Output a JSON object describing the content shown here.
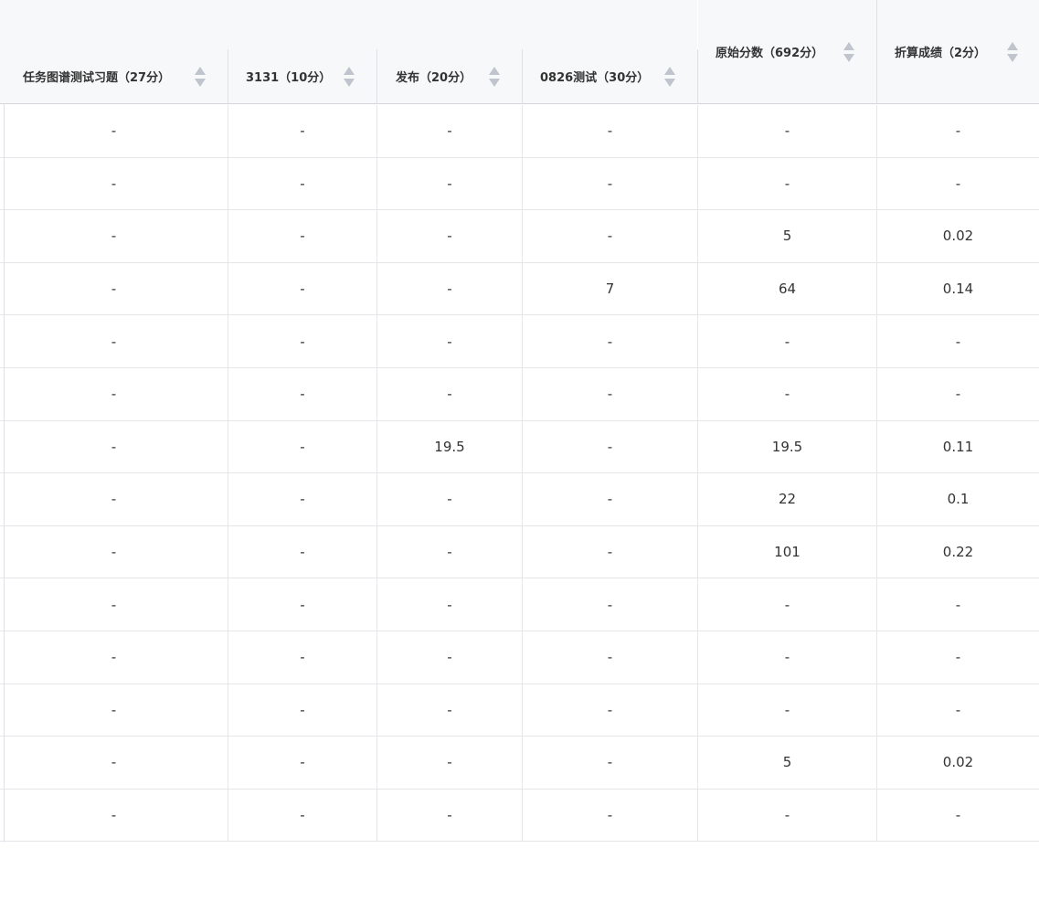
{
  "columns": [
    {
      "key": "c1",
      "label": "任务图谱测试习题（27分）"
    },
    {
      "key": "c2",
      "label": "3131（10分）"
    },
    {
      "key": "c3",
      "label": "发布（20分）"
    },
    {
      "key": "c4",
      "label": "0826测试（30分）"
    },
    {
      "key": "c5",
      "label": "原始分数（692分）"
    },
    {
      "key": "c6",
      "label": "折算成绩（2分）"
    }
  ],
  "rows": [
    [
      "-",
      "-",
      "-",
      "-",
      "-",
      "-"
    ],
    [
      "-",
      "-",
      "-",
      "-",
      "-",
      "-"
    ],
    [
      "-",
      "-",
      "-",
      "-",
      "5",
      "0.02"
    ],
    [
      "-",
      "-",
      "-",
      "7",
      "64",
      "0.14"
    ],
    [
      "-",
      "-",
      "-",
      "-",
      "-",
      "-"
    ],
    [
      "-",
      "-",
      "-",
      "-",
      "-",
      "-"
    ],
    [
      "-",
      "-",
      "19.5",
      "-",
      "19.5",
      "0.11"
    ],
    [
      "-",
      "-",
      "-",
      "-",
      "22",
      "0.1"
    ],
    [
      "-",
      "-",
      "-",
      "-",
      "101",
      "0.22"
    ],
    [
      "-",
      "-",
      "-",
      "-",
      "-",
      "-"
    ],
    [
      "-",
      "-",
      "-",
      "-",
      "-",
      "-"
    ],
    [
      "-",
      "-",
      "-",
      "-",
      "-",
      "-"
    ],
    [
      "-",
      "-",
      "-",
      "-",
      "5",
      "0.02"
    ],
    [
      "-",
      "-",
      "-",
      "-",
      "-",
      "-"
    ]
  ],
  "icons": {
    "sort": "sort-caret-icon"
  },
  "colors": {
    "header_bg": "#f7f8fa",
    "border": "#e4e6ea",
    "sort_caret": "#c0c4cc"
  }
}
